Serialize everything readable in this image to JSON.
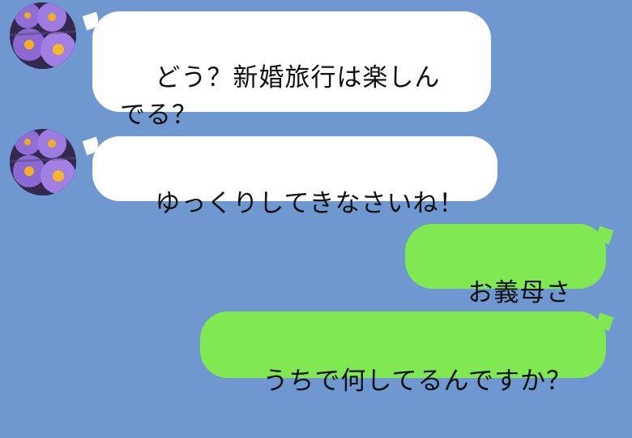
{
  "colors": {
    "background": "#6f98d1",
    "incoming_bubble": "#ffffff",
    "outgoing_bubble": "#80e850"
  },
  "messages": [
    {
      "sender": "other",
      "avatar_icon": "flower-avatar-icon",
      "text": "どう？新婚旅行は楽しんでる？"
    },
    {
      "sender": "other",
      "avatar_icon": "flower-avatar-icon",
      "text": "ゆっくりしてきなさいね！"
    },
    {
      "sender": "me",
      "text": "お義母さん"
    },
    {
      "sender": "me",
      "text": "うちで何してるんですか？"
    }
  ]
}
